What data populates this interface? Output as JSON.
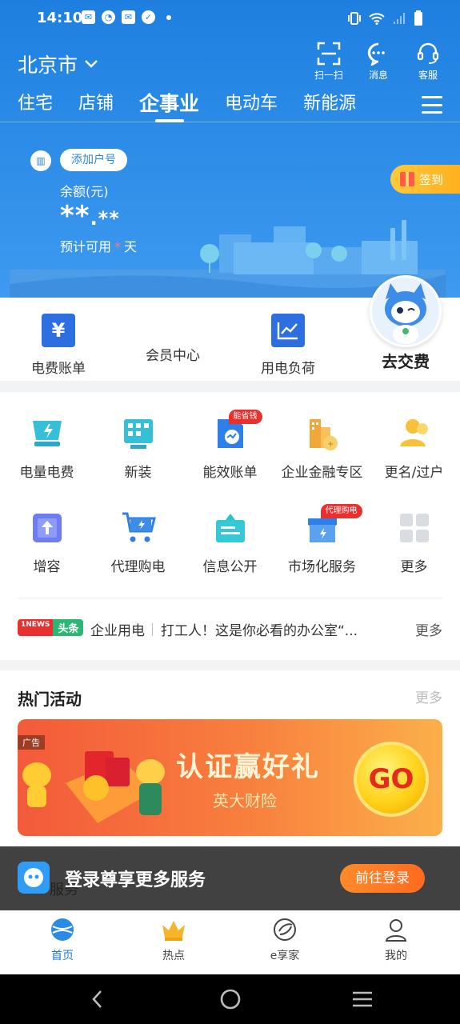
{
  "status_bar": {
    "time": "14:10"
  },
  "header": {
    "city": "北京市",
    "buttons": [
      {
        "label": "扫一扫",
        "icon": "scan-icon"
      },
      {
        "label": "消息",
        "icon": "message-icon"
      },
      {
        "label": "客服",
        "icon": "headset-icon"
      }
    ],
    "tabs": [
      "住宅",
      "店铺",
      "企事业",
      "电动车",
      "新能源"
    ],
    "active_tab": "企事业"
  },
  "account": {
    "add_account": "添加户号",
    "balance_label": "余额(元)",
    "balance_masked_int": "**",
    "balance_masked_dec": ".**",
    "available_prefix": "预计可用",
    "available_star": "*",
    "available_suffix": "天",
    "sign_in": "签到"
  },
  "quick": [
    {
      "label": "电费账单",
      "icon": "yuan-bill-icon"
    },
    {
      "label": "会员中心",
      "icon": ""
    },
    {
      "label": "用电负荷",
      "icon": "load-chart-icon"
    }
  ],
  "pay_label": "去交费",
  "services": [
    {
      "label": "电量电费",
      "icon": "power-usage-icon"
    },
    {
      "label": "新装",
      "icon": "new-install-icon"
    },
    {
      "label": "能效账单",
      "icon": "efficiency-bill-icon",
      "badge": "能省钱"
    },
    {
      "label": "企业金融专区",
      "icon": "finance-icon"
    },
    {
      "label": "更名/过户",
      "icon": "transfer-user-icon"
    },
    {
      "label": "增容",
      "icon": "capacity-up-icon"
    },
    {
      "label": "代理购电",
      "icon": "cart-icon"
    },
    {
      "label": "信息公开",
      "icon": "info-board-icon"
    },
    {
      "label": "市场化服务",
      "icon": "market-service-icon",
      "badge": "代理购电"
    },
    {
      "label": "更多",
      "icon": "more-grid-icon"
    }
  ],
  "news": {
    "logo_a": "1NEWS",
    "logo_b": "头条",
    "category": "企业用电",
    "text": "打工人！这是你必看的办公室“...",
    "more": "更多"
  },
  "activities": {
    "title": "热门活动",
    "more": "更多",
    "ad_tag": "广告",
    "banner_title": "认证赢好礼",
    "banner_sub": "英大财险",
    "go": "GO"
  },
  "login": {
    "text": "登录尊享更多服务",
    "underlay": "服务",
    "button": "前往登录"
  },
  "bottom_nav": [
    {
      "label": "首页",
      "icon": "home-globe-icon"
    },
    {
      "label": "热点",
      "icon": "crown-icon"
    },
    {
      "label": "e享家",
      "icon": "e-home-icon"
    },
    {
      "label": "我的",
      "icon": "profile-icon"
    }
  ],
  "colors": {
    "primary": "#2a86e4",
    "accent": "#ff6a1f",
    "badge": "#e8302f"
  }
}
